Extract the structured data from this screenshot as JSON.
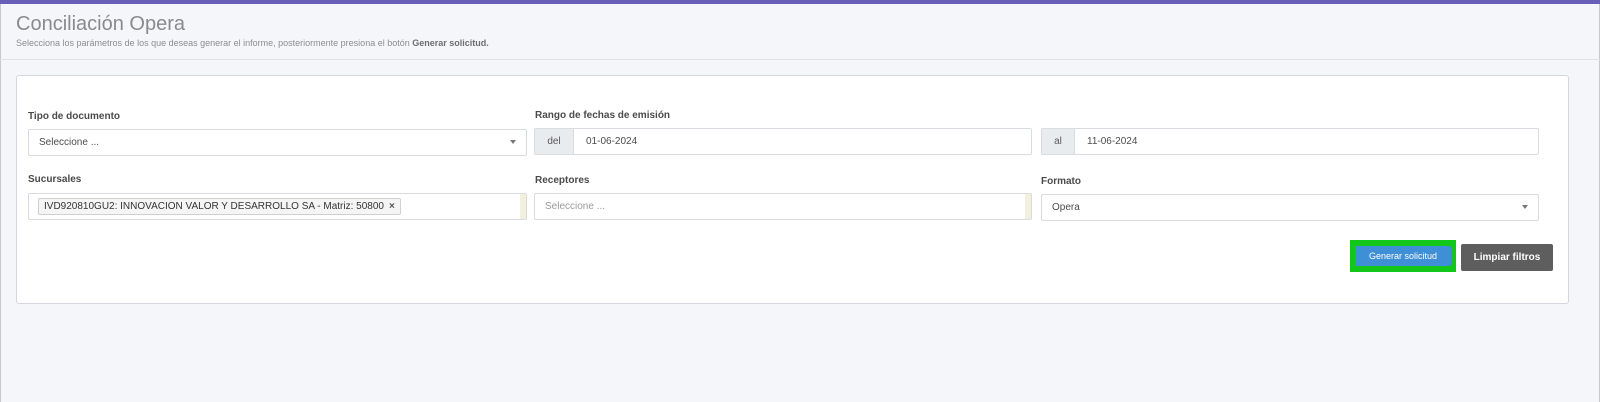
{
  "header": {
    "title": "Conciliación Opera",
    "subtitle_prefix": "Selecciona los parámetros de los que deseas generar el informe, posteriormente presiona el botón",
    "subtitle_bold": "Generar solicitud."
  },
  "form": {
    "tipo_documento": {
      "label": "Tipo de documento",
      "value": "Seleccione ..."
    },
    "rango_fechas": {
      "label": "Rango de fechas de emisión",
      "from_prefix": "del",
      "from_value": "01-06-2024",
      "to_prefix": "al",
      "to_value": "11-06-2024"
    },
    "sucursales": {
      "label": "Sucursales",
      "chip": "IVD920810GU2: INNOVACION VALOR Y DESARROLLO SA - Matriz: 50800",
      "chip_remove": "×"
    },
    "receptores": {
      "label": "Receptores",
      "placeholder": "Seleccione ..."
    },
    "formato": {
      "label": "Formato",
      "value": "Opera"
    }
  },
  "buttons": {
    "generate": "Generar solicitud",
    "clear": "Limpiar filtros"
  },
  "colors": {
    "topbar": "#6a5fb8",
    "primary": "#3f8fd6",
    "highlight": "#12c71a",
    "secondary": "#5e5e5e"
  }
}
